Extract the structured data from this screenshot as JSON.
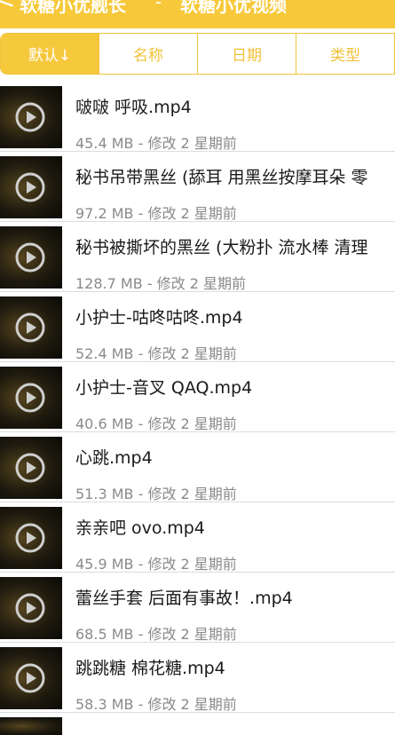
{
  "header": {
    "back_label": "<",
    "breadcrumb": "软糖小优舰长",
    "separator": "-",
    "title": "软糖小优视频"
  },
  "sort_tabs": [
    {
      "label": "默认↓",
      "active": true
    },
    {
      "label": "名称",
      "active": false
    },
    {
      "label": "日期",
      "active": false
    },
    {
      "label": "类型",
      "active": false
    }
  ],
  "files": [
    {
      "name": "啵啵 呼吸.mp4",
      "meta": "45.4 MB - 修改 2 星期前"
    },
    {
      "name": "秘书吊带黑丝 (舔耳 用黑丝按摩耳朵 零",
      "meta": "97.2 MB - 修改 2 星期前"
    },
    {
      "name": "秘书被撕坏的黑丝 (大粉扑 流水棒 清理",
      "meta": "128.7 MB - 修改 2 星期前"
    },
    {
      "name": "小护士-咕咚咕咚.mp4",
      "meta": "52.4 MB - 修改 2 星期前"
    },
    {
      "name": "小护士-音叉 QAQ.mp4",
      "meta": "40.6 MB - 修改 2 星期前"
    },
    {
      "name": "心跳.mp4",
      "meta": "51.3 MB - 修改 2 星期前"
    },
    {
      "name": "亲亲吧 ovo.mp4",
      "meta": "45.9 MB - 修改 2 星期前"
    },
    {
      "name": "蕾丝手套 后面有事故！.mp4",
      "meta": "68.5 MB - 修改 2 星期前"
    },
    {
      "name": "跳跳糖 棉花糖.mp4",
      "meta": "58.3 MB - 修改 2 星期前"
    }
  ],
  "colors": {
    "accent": "#f6c83c",
    "header": "#f7c839",
    "meta_text": "#8a8a8a"
  }
}
